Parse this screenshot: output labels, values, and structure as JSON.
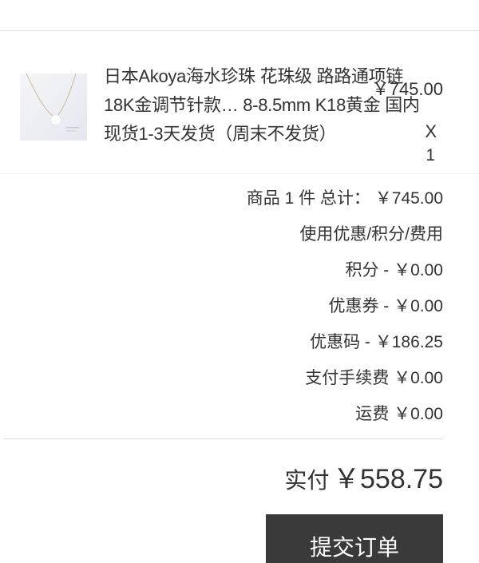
{
  "product": {
    "name": "日本Akoya海水珍珠 花珠级 路路通项链18K金调节针款… 8-8.5mm K18黄金 国内现货1-3天发货（周末不发货）",
    "price": "￥745.00",
    "quantity_prefix": "X",
    "quantity": "1",
    "thumbnail_icon": "pearl-necklace-image"
  },
  "summary": {
    "goods_total": "商品 1 件 总计： ￥745.00",
    "discount_header": "使用优惠/积分/费用",
    "points": "积分 - ￥0.00",
    "coupon": "优惠券 - ￥0.00",
    "promo_code": "优惠码 - ￥186.25",
    "payment_fee": "支付手续费 ￥0.00",
    "shipping": "运费 ￥0.00"
  },
  "total": {
    "label": "实付",
    "value": "￥558.75"
  },
  "submit_label": "提交订单",
  "colors": {
    "text": "#333333",
    "button_bg": "#3a3a3a",
    "button_text": "#ffffff",
    "divider": "#e2e2e2"
  }
}
